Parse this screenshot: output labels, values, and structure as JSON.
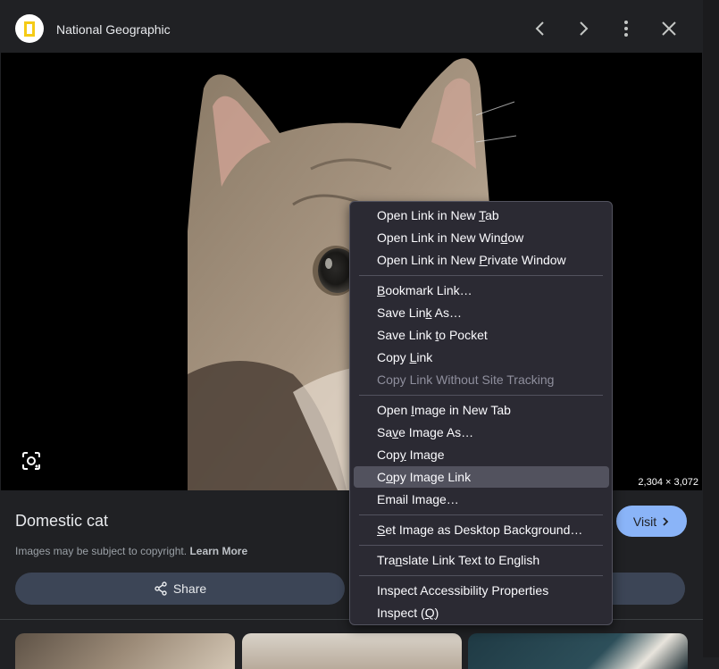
{
  "source": {
    "name": "National Geographic",
    "logo_icon": "national-geographic-logo"
  },
  "topbar": {
    "prev_icon": "chevron-left-icon",
    "next_icon": "chevron-right-icon",
    "more_icon": "more-vert-icon",
    "close_icon": "close-icon"
  },
  "image": {
    "dimensions": "2,304 × 3,072",
    "lens_icon": "lens-icon"
  },
  "details": {
    "title": "Domestic cat",
    "visit_label": "Visit",
    "copyright_text": "Images may be subject to copyright.",
    "learn_more": "Learn More",
    "share_label": "Share"
  },
  "context_menu": {
    "groups": [
      [
        {
          "pre": "Open Link in New ",
          "key": "T",
          "post": "ab"
        },
        {
          "pre": "Open Link in New Win",
          "key": "d",
          "post": "ow"
        },
        {
          "pre": "Open Link in New ",
          "key": "P",
          "post": "rivate Window"
        }
      ],
      [
        {
          "pre": "",
          "key": "B",
          "post": "ookmark Link…"
        },
        {
          "pre": "Save Lin",
          "key": "k",
          "post": " As…"
        },
        {
          "pre": "Save Link ",
          "key": "t",
          "post": "o Pocket"
        },
        {
          "pre": "Copy ",
          "key": "L",
          "post": "ink"
        },
        {
          "pre": "Copy Link Without Site Tracking",
          "key": "",
          "post": "",
          "disabled": true
        }
      ],
      [
        {
          "pre": "Open ",
          "key": "I",
          "post": "mage in New Tab"
        },
        {
          "pre": "Sa",
          "key": "v",
          "post": "e Image As…"
        },
        {
          "pre": "Cop",
          "key": "y",
          "post": " Image"
        },
        {
          "pre": "C",
          "key": "o",
          "post": "py Image Link",
          "active": true
        },
        {
          "pre": "Email Image…",
          "key": "",
          "post": ""
        }
      ],
      [
        {
          "pre": "",
          "key": "S",
          "post": "et Image as Desktop Background…"
        }
      ],
      [
        {
          "pre": "Tra",
          "key": "n",
          "post": "slate Link Text to English"
        }
      ],
      [
        {
          "pre": "Inspect Accessibility Properties",
          "key": "",
          "post": ""
        },
        {
          "pre": "Inspect (",
          "key": "Q",
          "post": ")"
        }
      ]
    ]
  },
  "colors": {
    "background": "#202124",
    "accent": "#8ab4f8",
    "menu_bg": "#2b2a33",
    "menu_highlight": "#52525e"
  }
}
